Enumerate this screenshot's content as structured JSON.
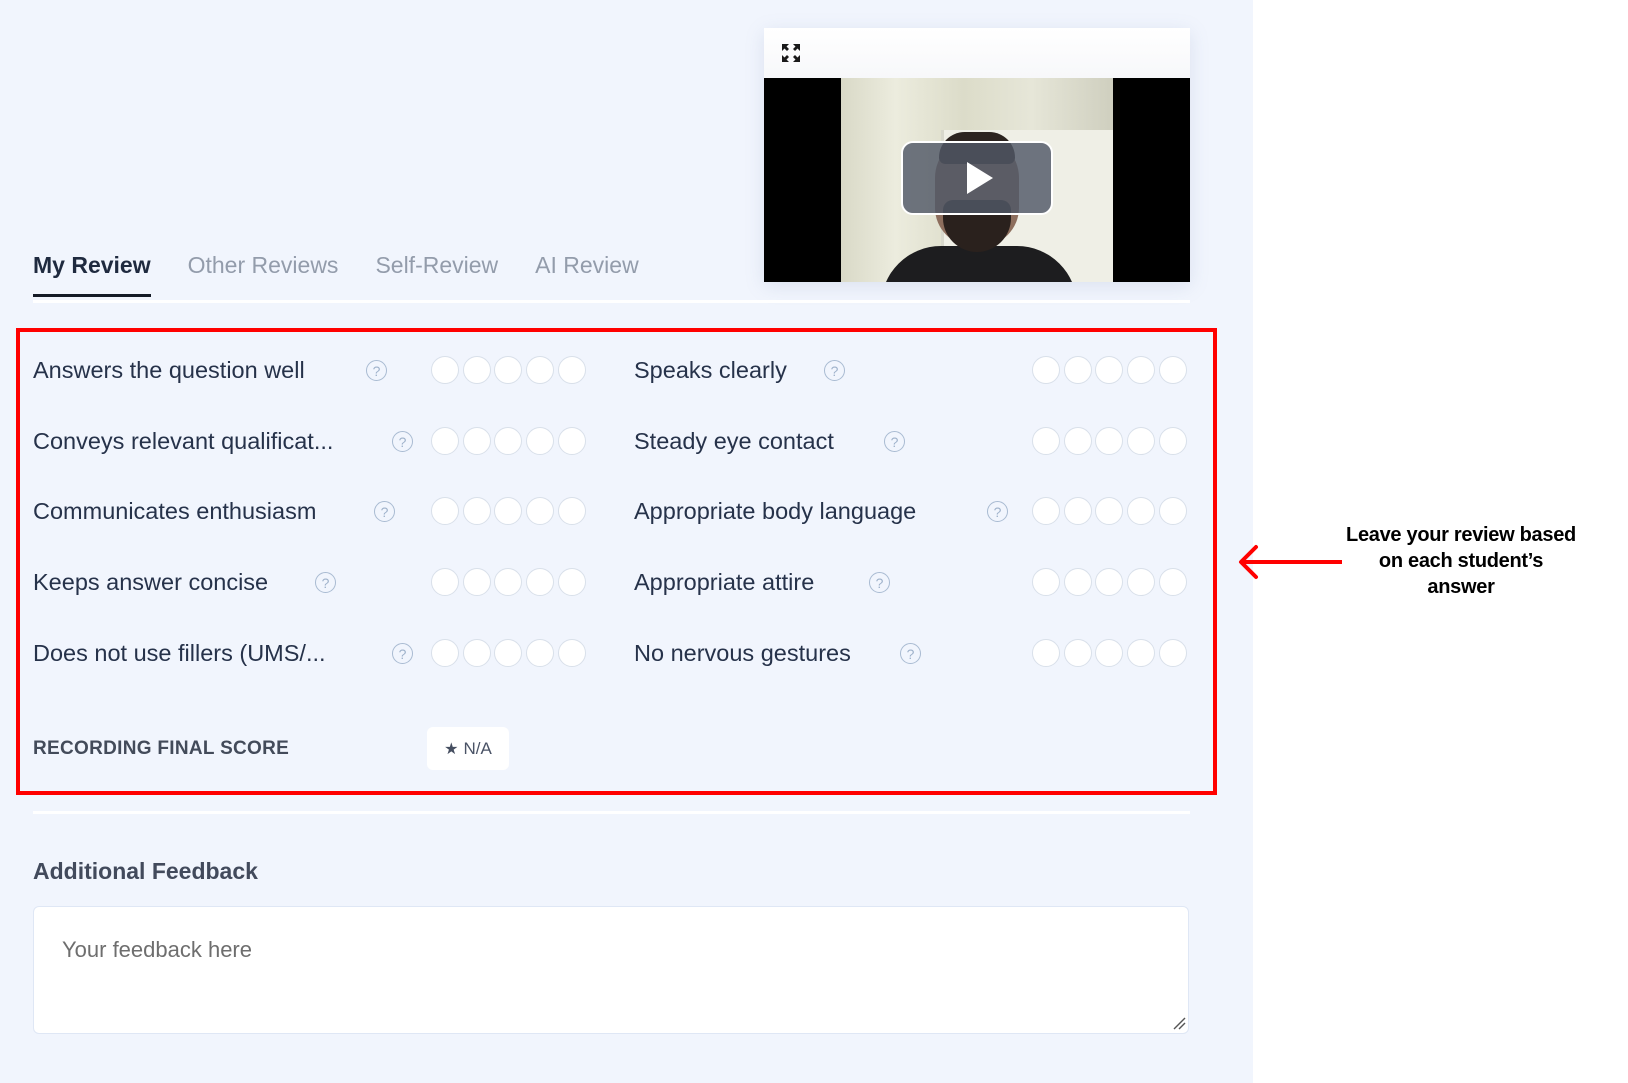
{
  "video": {
    "expand_icon": "expand-arrows-icon",
    "play_icon": "play-icon"
  },
  "tabs": [
    {
      "label": "My Review",
      "active": true
    },
    {
      "label": "Other Reviews",
      "active": false
    },
    {
      "label": "Self-Review",
      "active": false
    },
    {
      "label": "AI Review",
      "active": false
    }
  ],
  "criteria": {
    "left": [
      {
        "label": "Answers the question well",
        "rating": 0,
        "max": 5
      },
      {
        "label": "Conveys relevant qualificat...",
        "rating": 0,
        "max": 5
      },
      {
        "label": "Communicates enthusiasm",
        "rating": 0,
        "max": 5
      },
      {
        "label": "Keeps answer concise",
        "rating": 0,
        "max": 5
      },
      {
        "label": "Does not use fillers (UMS/...",
        "rating": 0,
        "max": 5
      }
    ],
    "right": [
      {
        "label": "Speaks clearly",
        "rating": 0,
        "max": 5
      },
      {
        "label": "Steady eye contact",
        "rating": 0,
        "max": 5
      },
      {
        "label": "Appropriate body language",
        "rating": 0,
        "max": 5
      },
      {
        "label": "Appropriate attire",
        "rating": 0,
        "max": 5
      },
      {
        "label": "No nervous gestures",
        "rating": 0,
        "max": 5
      }
    ],
    "help_glyph": "?"
  },
  "final_score": {
    "label": "RECORDING FINAL SCORE",
    "star": "★",
    "value": "N/A"
  },
  "feedback": {
    "title": "Additional Feedback",
    "placeholder": "Your feedback here",
    "value": ""
  },
  "annotation": {
    "text": "Leave your review based on each student’s answer",
    "color": "#ff0000"
  }
}
